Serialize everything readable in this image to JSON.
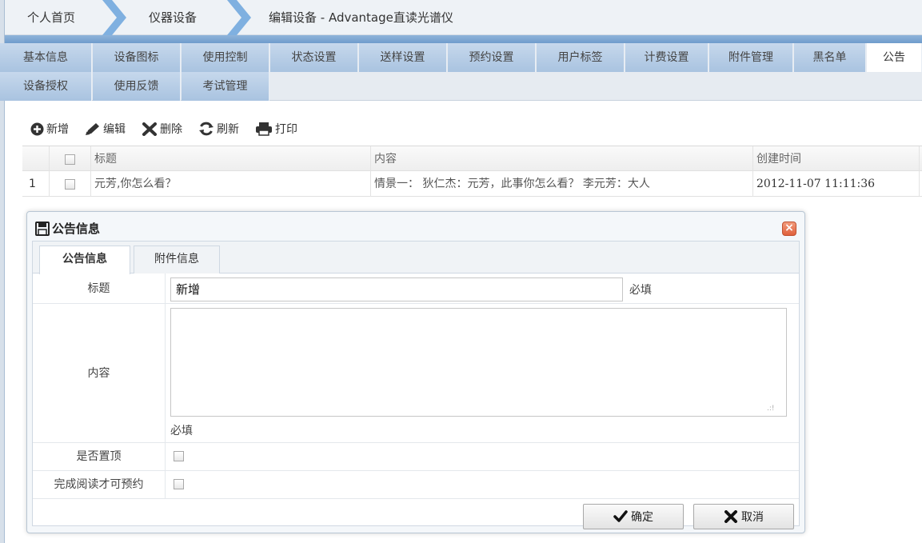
{
  "breadcrumb": {
    "home": "个人首页",
    "equipment": "仪器设备",
    "current": "编辑设备 - Advantage直读光谱仪"
  },
  "tabs_row1": [
    "基本信息",
    "设备图标",
    "使用控制",
    "状态设置",
    "送样设置",
    "预约设置",
    "用户标签",
    "计费设置",
    "附件管理",
    "黑名单",
    "公告"
  ],
  "tabs_row2": [
    "设备授权",
    "使用反馈",
    "考试管理"
  ],
  "active_tab": "公告",
  "toolbar": {
    "add": "新增",
    "edit": "编辑",
    "delete": "删除",
    "refresh": "刷新",
    "print": "打印"
  },
  "grid": {
    "columns": [
      "标题",
      "内容",
      "创建时间"
    ],
    "rows": [
      {
        "index": "1",
        "title": "元芳,你怎么看？",
        "content": "情景一： 狄仁杰：元芳，此事你怎么看？ 李元芳：大人",
        "created": "2012-11-07 11:11:36"
      }
    ]
  },
  "dialog": {
    "title": "公告信息",
    "tabs": [
      "公告信息",
      "附件信息"
    ],
    "fields": {
      "title_label": "标题",
      "title_value": "新增",
      "title_required": "必填",
      "content_label": "内容",
      "content_value": "",
      "content_required": "必填",
      "pin_label": "是否置顶",
      "read_label": "完成阅读才可预约"
    },
    "ok": "确定",
    "cancel": "取消"
  },
  "colors": {
    "tab_bg": "#b7cde6",
    "blue_bar": "#7aa5d3",
    "close_btn": "#e0603c"
  }
}
